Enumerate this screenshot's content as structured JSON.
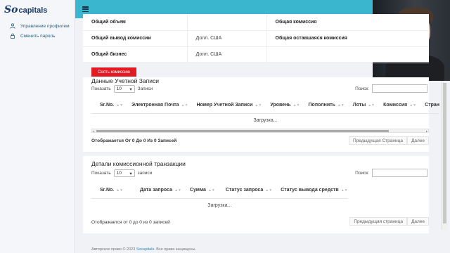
{
  "brand": {
    "logo_so": "So",
    "logo_text": "capitals"
  },
  "sidebar": {
    "items": [
      {
        "label": "Управление профилем",
        "icon": "user-icon"
      },
      {
        "label": "Сменить пароль",
        "icon": "lock-icon"
      }
    ]
  },
  "summary": {
    "rows": [
      {
        "label": "Общий объем",
        "value": "",
        "label2": "Общая комиссия"
      },
      {
        "label": "Общий вывод комиссии",
        "value": "Долл. США",
        "label2": "Общая оставшаяся комиссия"
      },
      {
        "label": "Общий бизнес",
        "value": "Долл. США",
        "label2": ""
      }
    ],
    "withdraw_button": "Снять комиссию"
  },
  "accounts": {
    "title": "Данные Учетной Записи",
    "show_label": "Показать",
    "show_value": "10",
    "entries_label": "Записи",
    "search_label": "Поиск:",
    "columns": [
      "Sr.No.",
      "Электронная Почта",
      "Номер Учетной Записи",
      "Уровень",
      "Пополнить",
      "Лоты",
      "Комиссия",
      "Стран"
    ],
    "loading": "Загрузка...",
    "info": "Отображается От 0 До 0 Из 0 Записей",
    "prev": "Предыдущая Страница",
    "next": "Далее"
  },
  "transactions": {
    "title": "Детали комиссионной транзакции",
    "show_label": "Показать",
    "show_value": "10",
    "entries_label": "записи",
    "search_label": "Поиск:",
    "columns": [
      "Sr.No.",
      "Дата запроса",
      "Сумма",
      "Статус запроса",
      "Статус вывода средств"
    ],
    "loading": "Загрузка...",
    "info": "Отображается от 0 до 0 из 0 записей",
    "prev": "Предыдущая страница",
    "next": "Далее"
  },
  "footer": {
    "prefix": "Авторское право © 2023",
    "link": "Socapitals",
    "suffix": ". Все права защищены."
  }
}
